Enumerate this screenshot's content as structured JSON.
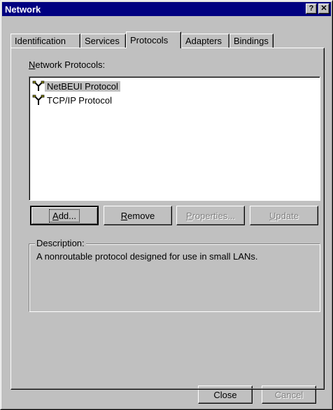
{
  "window": {
    "title": "Network"
  },
  "titlebar_buttons": {
    "help": "?",
    "close": "✕"
  },
  "tabs": [
    {
      "label": "Identification",
      "active": false
    },
    {
      "label": "Services",
      "active": false
    },
    {
      "label": "Protocols",
      "active": true
    },
    {
      "label": "Adapters",
      "active": false
    },
    {
      "label": "Bindings",
      "active": false
    }
  ],
  "protocols": {
    "list_label_accel": "N",
    "list_label_rest": "etwork Protocols:",
    "items": [
      {
        "label": "NetBEUI Protocol",
        "selected": true,
        "icon": "network-protocol-icon"
      },
      {
        "label": "TCP/IP Protocol",
        "selected": false,
        "icon": "network-protocol-icon"
      }
    ]
  },
  "buttons": {
    "add": {
      "accel": "A",
      "rest": "dd...",
      "enabled": true
    },
    "remove": {
      "accel": "R",
      "rest": "emove",
      "enabled": true
    },
    "properties": {
      "accel": "P",
      "rest": "roperties...",
      "enabled": false
    },
    "update": {
      "accel": "U",
      "rest": "pdate",
      "enabled": false
    }
  },
  "description": {
    "legend": "Description:",
    "text": "A nonroutable protocol designed for use in small LANs."
  },
  "footer": {
    "close": "Close",
    "cancel": "Cancel",
    "cancel_enabled": false
  }
}
